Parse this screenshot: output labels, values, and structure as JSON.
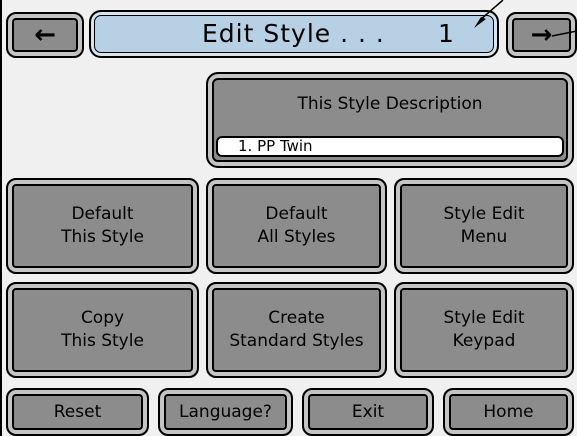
{
  "header": {
    "title": "Edit Style . . .",
    "style_number": "1",
    "prev_icon": "left-arrow-icon",
    "next_icon": "right-arrow-icon"
  },
  "description": {
    "label": "This Style Description",
    "value": "1. PP Twin"
  },
  "grid": {
    "default_this_style": "Default\nThis Style",
    "default_all_styles": "Default\nAll Styles",
    "style_edit_menu": "Style Edit\nMenu",
    "copy_this_style": "Copy\nThis Style",
    "create_standard_styles": "Create\nStandard Styles",
    "style_edit_keypad": "Style Edit\nKeypad"
  },
  "footer": {
    "reset": "Reset",
    "language": "Language?",
    "exit": "Exit",
    "home": "Home"
  },
  "colors": {
    "button_fill": "#8c8c8c",
    "button_bevel": "#c4c4c4",
    "title_fill": "#b7d0e3",
    "screen_bg": "#f0f0f0"
  }
}
